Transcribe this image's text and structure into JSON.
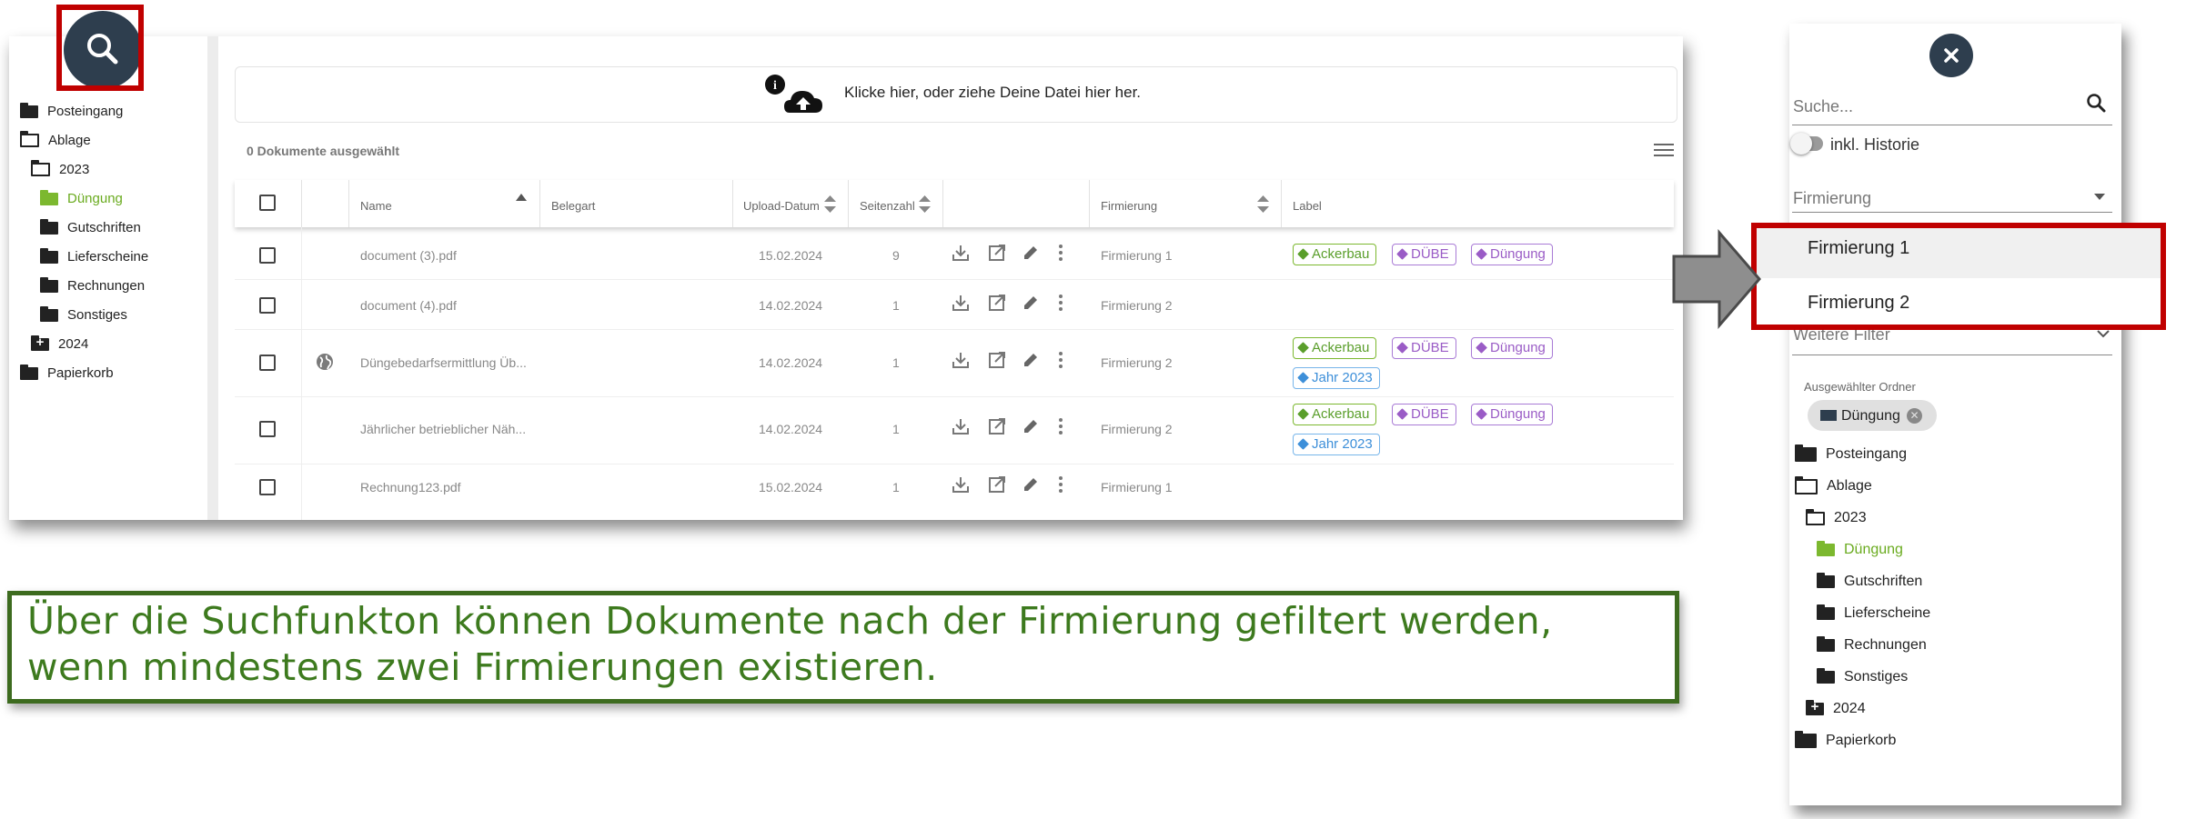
{
  "sidebar": {
    "items": [
      {
        "label": "Posteingang"
      },
      {
        "label": "Ablage"
      },
      {
        "label": "2023"
      },
      {
        "label": "Düngung"
      },
      {
        "label": "Gutschriften"
      },
      {
        "label": "Lieferscheine"
      },
      {
        "label": "Rechnungen"
      },
      {
        "label": "Sonstiges"
      },
      {
        "label": "2024"
      },
      {
        "label": "Papierkorb"
      }
    ]
  },
  "upload": {
    "text": "Klicke hier, oder ziehe Deine Datei hier her."
  },
  "selection": {
    "count_text": "0 Dokumente ausgewählt"
  },
  "table": {
    "headers": {
      "name": "Name",
      "belegart": "Belegart",
      "upload_datum": "Upload-Datum",
      "seitenzahl": "Seitenzahl",
      "firmierung": "Firmierung",
      "label": "Label"
    },
    "rows": [
      {
        "name": "document (3).pdf",
        "date": "15.02.2024",
        "pages": "9",
        "firm": "Firmierung 1",
        "tags": [
          {
            "text": "Ackerbau"
          },
          {
            "text": "DÜBE"
          },
          {
            "text": "Düngung"
          }
        ]
      },
      {
        "name": "document (4).pdf",
        "date": "14.02.2024",
        "pages": "1",
        "firm": "Firmierung 2",
        "tags": []
      },
      {
        "name": "Düngebedarfsermittlung Üb...",
        "date": "14.02.2024",
        "pages": "1",
        "firm": "Firmierung 2",
        "tags": [
          {
            "text": "Ackerbau"
          },
          {
            "text": "DÜBE"
          },
          {
            "text": "Düngung"
          },
          {
            "text": "Jahr 2023"
          }
        ]
      },
      {
        "name": "Jährlicher betrieblicher Näh...",
        "date": "14.02.2024",
        "pages": "1",
        "firm": "Firmierung 2",
        "tags": [
          {
            "text": "Ackerbau"
          },
          {
            "text": "DÜBE"
          },
          {
            "text": "Düngung"
          },
          {
            "text": "Jahr 2023"
          }
        ]
      },
      {
        "name": "Rechnung123.pdf",
        "date": "15.02.2024",
        "pages": "1",
        "firm": "Firmierung 1",
        "tags": []
      }
    ]
  },
  "caption": {
    "text": "Über die Suchfunkton können Dokumente nach der Firmierung gefiltert werden, wenn mindestens zwei Firmierungen existieren."
  },
  "filter_panel": {
    "search_placeholder": "Suche...",
    "toggle_label": "inkl. Historie",
    "firm_select": "Firmierung",
    "options": [
      "Firmierung 1",
      "Firmierung 2"
    ],
    "weitere": "Weitere Filter",
    "selected_folder_label": "Ausgewählter Ordner",
    "selected_folder_chip": "Düngung",
    "tree": [
      {
        "label": "Posteingang"
      },
      {
        "label": "Ablage"
      },
      {
        "label": "2023"
      },
      {
        "label": "Düngung"
      },
      {
        "label": "Gutschriften"
      },
      {
        "label": "Lieferscheine"
      },
      {
        "label": "Rechnungen"
      },
      {
        "label": "Sonstiges"
      },
      {
        "label": "2024"
      },
      {
        "label": "Papierkorb"
      }
    ]
  },
  "colors": {
    "accent_green": "#6aab1f",
    "highlight_red": "#c00000",
    "caption_green": "#3d7a1e",
    "button_dark": "#2e3e4e"
  }
}
